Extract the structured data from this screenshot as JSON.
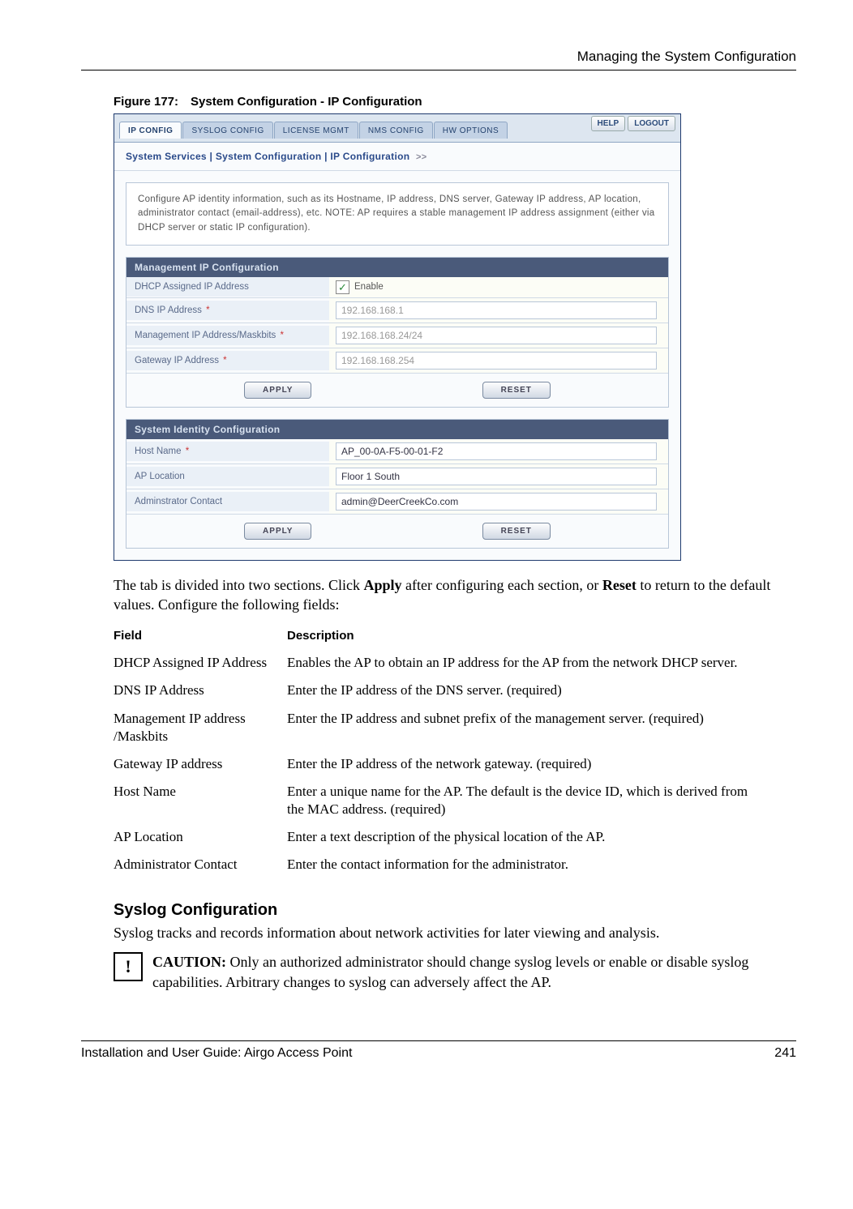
{
  "header": {
    "right_title": "Managing the System Configuration"
  },
  "figure": {
    "caption": "Figure 177: System Configuration - IP Configuration"
  },
  "screenshot": {
    "tabs": [
      "IP CONFIG",
      "SYSLOG CONFIG",
      "LICENSE MGMT",
      "NMS CONFIG",
      "HW OPTIONS"
    ],
    "topbuttons": {
      "help": "HELP",
      "logout": "LOGOUT"
    },
    "breadcrumb": "System Services | System Configuration | IP Configuration",
    "infobox": "Configure AP identity information, such as its Hostname, IP address, DNS server, Gateway IP address, AP location, administrator contact (email-address), etc. NOTE: AP requires a stable management IP address assignment (either via DHCP server or static IP configuration).",
    "panel1": {
      "title": "Management IP Configuration",
      "rows": {
        "dhcp_label": "DHCP Assigned IP Address",
        "dhcp_enable": "Enable",
        "dns_label": "DNS IP Address",
        "dns_value": "192.168.168.1",
        "mgmt_label": "Management IP Address/Maskbits",
        "mgmt_value": "192.168.168.24/24",
        "gw_label": "Gateway IP Address",
        "gw_value": "192.168.168.254"
      },
      "apply": "APPLY",
      "reset": "RESET"
    },
    "panel2": {
      "title": "System Identity Configuration",
      "rows": {
        "host_label": "Host Name",
        "host_value": "AP_00-0A-F5-00-01-F2",
        "loc_label": "AP Location",
        "loc_value": "Floor 1 South",
        "admin_label": "Adminstrator Contact",
        "admin_value": "admin@DeerCreekCo.com"
      },
      "apply": "APPLY",
      "reset": "RESET"
    }
  },
  "body1_a": "The tab is divided into two sections. Click ",
  "body1_b": "Apply",
  "body1_c": " after configuring each section, or ",
  "body1_d": "Reset",
  "body1_e": " to return to the default values. Configure the following fields:",
  "table": {
    "h1": "Field",
    "h2": "Description",
    "rows": [
      {
        "f": "DHCP Assigned IP Address",
        "d": "Enables the AP to obtain an IP address for the AP from the network DHCP server."
      },
      {
        "f": "DNS IP Address",
        "d": "Enter the IP address of the DNS server. (required)"
      },
      {
        "f": "Management IP address /Maskbits",
        "d": "Enter the IP address and subnet prefix of the management server. (required)"
      },
      {
        "f": "Gateway IP address",
        "d": "Enter the IP address of the network gateway. (required)"
      },
      {
        "f": "Host Name",
        "d": "Enter a unique name for the AP. The default is the device ID, which is derived from the MAC address. (required)"
      },
      {
        "f": "AP Location",
        "d": "Enter a text description of the physical location of the AP."
      },
      {
        "f": "Administrator Contact",
        "d": "Enter the contact information for the administrator."
      }
    ]
  },
  "section2": {
    "heading": "Syslog Configuration",
    "text": "Syslog tracks and records information about network activities for later viewing and analysis."
  },
  "caution": {
    "icon": "!",
    "label": "CAUTION:",
    "text": " Only an authorized administrator should change syslog levels or enable or disable syslog capabilities. Arbitrary changes to syslog can adversely affect the AP."
  },
  "footer": {
    "left": "Installation and User Guide: Airgo Access Point",
    "right": "241"
  }
}
